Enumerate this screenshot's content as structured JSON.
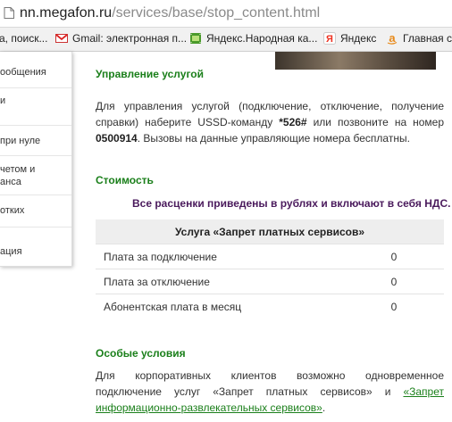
{
  "url": {
    "domain": "nn.megafon.ru",
    "path": "/services/base/stop_content.html"
  },
  "bookmarks": [
    {
      "label": "а, поиск...",
      "icon": "yandex-search-icon"
    },
    {
      "label": "Gmail: электронная п...",
      "icon": "gmail-icon"
    },
    {
      "label": "Яндекс.Народная ка...",
      "icon": "film-icon"
    },
    {
      "label": "Яндекс",
      "icon": "yandex-icon"
    },
    {
      "label": "Главная ст",
      "icon": "amazon-icon"
    }
  ],
  "sidebar": {
    "items": [
      {
        "lines": [
          "ообщения"
        ]
      },
      {
        "lines": [
          "и"
        ]
      },
      {
        "lines": [
          "при нуле"
        ]
      },
      {
        "lines": [
          "четом и",
          "анса"
        ]
      },
      {
        "lines": [
          "отких"
        ]
      },
      {
        "lines": [
          "ация"
        ]
      }
    ]
  },
  "management": {
    "heading": "Управление услугой",
    "text_1": "Для управления услугой (подключение, отключение, получение справки) наберите USSD-команду ",
    "ussd": "*526#",
    "text_2": " или позвоните на номер ",
    "number": "0500914",
    "text_3": ". Вызовы на данные управляющие номера бесплатны."
  },
  "cost": {
    "heading": "Стоимость",
    "vat_note": "Все расценки приведены в рублях и включают в себя НДС.",
    "table_header": "Услуга «Запрет платных сервисов»",
    "rows": [
      {
        "name": "Плата за подключение",
        "value": "0"
      },
      {
        "name": "Плата за отключение",
        "value": "0"
      },
      {
        "name": "Абонентская плата в месяц",
        "value": "0"
      }
    ]
  },
  "special": {
    "heading": "Особые условия",
    "text_1": "Для корпоративных клиентов возможно одновременное подключение услуг «Запрет платных сервисов» и ",
    "link": "«Запрет информационно-развлекательных сервисов»",
    "text_2": "."
  }
}
